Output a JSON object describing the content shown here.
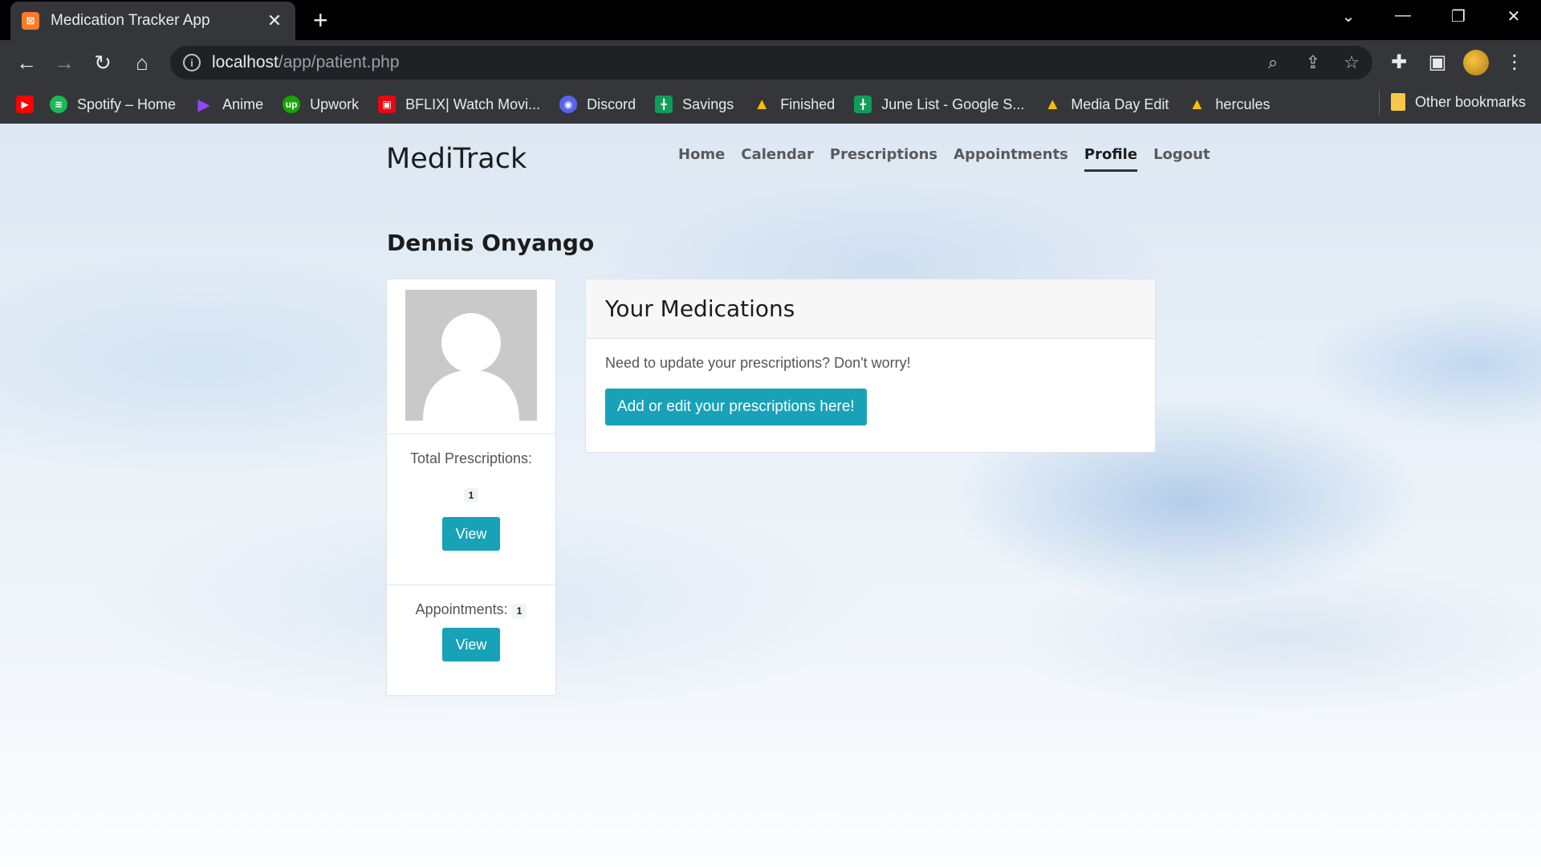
{
  "browser": {
    "tab_title": "Medication Tracker App",
    "tab_favicon": "xampp-icon",
    "url_host": "localhost",
    "url_path": "/app/patient.php",
    "bookmarks": [
      {
        "label": "",
        "icon": "youtube-icon",
        "color": "#ff0000"
      },
      {
        "label": "Spotify – Home",
        "icon": "spotify-icon",
        "color": "#1db954"
      },
      {
        "label": "Anime",
        "icon": "play-icon",
        "color": "#9146ff"
      },
      {
        "label": "Upwork",
        "icon": "upwork-icon",
        "color": "#14a800"
      },
      {
        "label": "BFLIX| Watch Movi...",
        "icon": "bflix-icon",
        "color": "#e50914"
      },
      {
        "label": "Discord",
        "icon": "discord-icon",
        "color": "#5865f2"
      },
      {
        "label": "Savings",
        "icon": "sheets-icon",
        "color": "#0f9d58"
      },
      {
        "label": "Finished",
        "icon": "drive-icon",
        "color": "#fbbc04"
      },
      {
        "label": "June List - Google S...",
        "icon": "sheets-icon",
        "color": "#0f9d58"
      },
      {
        "label": "Media Day Edit",
        "icon": "drive-icon",
        "color": "#fbbc04"
      },
      {
        "label": "hercules",
        "icon": "drive-icon",
        "color": "#fbbc04"
      }
    ],
    "other_bookmarks": "Other bookmarks"
  },
  "site": {
    "brand": "MediTrack",
    "nav": [
      {
        "label": "Home",
        "active": false
      },
      {
        "label": "Calendar",
        "active": false
      },
      {
        "label": "Prescriptions",
        "active": false
      },
      {
        "label": "Appointments",
        "active": false
      },
      {
        "label": "Profile",
        "active": true
      },
      {
        "label": "Logout",
        "active": false
      }
    ]
  },
  "profile": {
    "name": "Dennis Onyango",
    "total_prescriptions_label": "Total Prescriptions:",
    "total_prescriptions_count": "1",
    "appointments_label": "Appointments:",
    "appointments_count": "1",
    "view_label": "View"
  },
  "medications": {
    "title": "Your Medications",
    "text": "Need to update your prescriptions? Don't worry!",
    "button": "Add or edit your prescriptions here!"
  },
  "colors": {
    "accent": "#17a2b8"
  }
}
